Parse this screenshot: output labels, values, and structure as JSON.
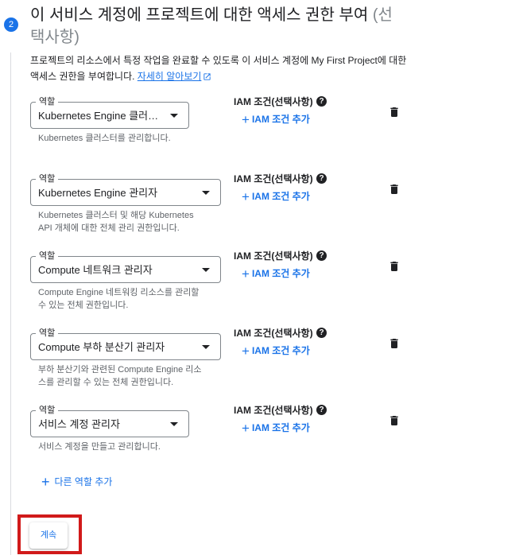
{
  "step": {
    "number": "2",
    "title": "이 서비스 계정에 프로젝트에 대한 액세스 권한 부여",
    "optional": "(선택사항)"
  },
  "description": {
    "text": "프로젝트의 리소스에서 특정 작업을 완료할 수 있도록 이 서비스 계정에 My First Project에 대한 액세스 권한을 부여합니다.",
    "link": "자세히 알아보기"
  },
  "roles": [
    {
      "label": "역할",
      "value": "Kubernetes Engine 클러스...",
      "hint": "Kubernetes 클러스터를 관리합니다.",
      "iam_title": "IAM 조건(선택사항)",
      "iam_add": "IAM 조건 추가"
    },
    {
      "label": "역할",
      "value": "Kubernetes Engine 관리자",
      "hint": "Kubernetes 클러스터 및 해당 Kubernetes API 개체에 대한 전체 관리 권한입니다.",
      "iam_title": "IAM 조건(선택사항)",
      "iam_add": "IAM 조건 추가"
    },
    {
      "label": "역할",
      "value": "Compute 네트워크 관리자",
      "hint": "Compute Engine 네트워킹 리소스를 관리할 수 있는 전체 권한입니다.",
      "iam_title": "IAM 조건(선택사항)",
      "iam_add": "IAM 조건 추가"
    },
    {
      "label": "역할",
      "value": "Compute 부하 분산기 관리자",
      "hint": "부하 분산기와 관련된 Compute Engine 리소스를 관리할 수 있는 전체 권한입니다.",
      "iam_title": "IAM 조건(선택사항)",
      "iam_add": "IAM 조건 추가"
    },
    {
      "label": "역할",
      "value": "서비스 계정 관리자",
      "hint": "서비스 계정을 만들고 관리합니다.",
      "iam_title": "IAM 조건(선택사항)",
      "iam_add": "IAM 조건 추가"
    }
  ],
  "add_role_label": "다른 역할 추가",
  "continue_label": "계속",
  "colors": {
    "accent": "#1a73e8",
    "highlight": "#d11a1a"
  }
}
